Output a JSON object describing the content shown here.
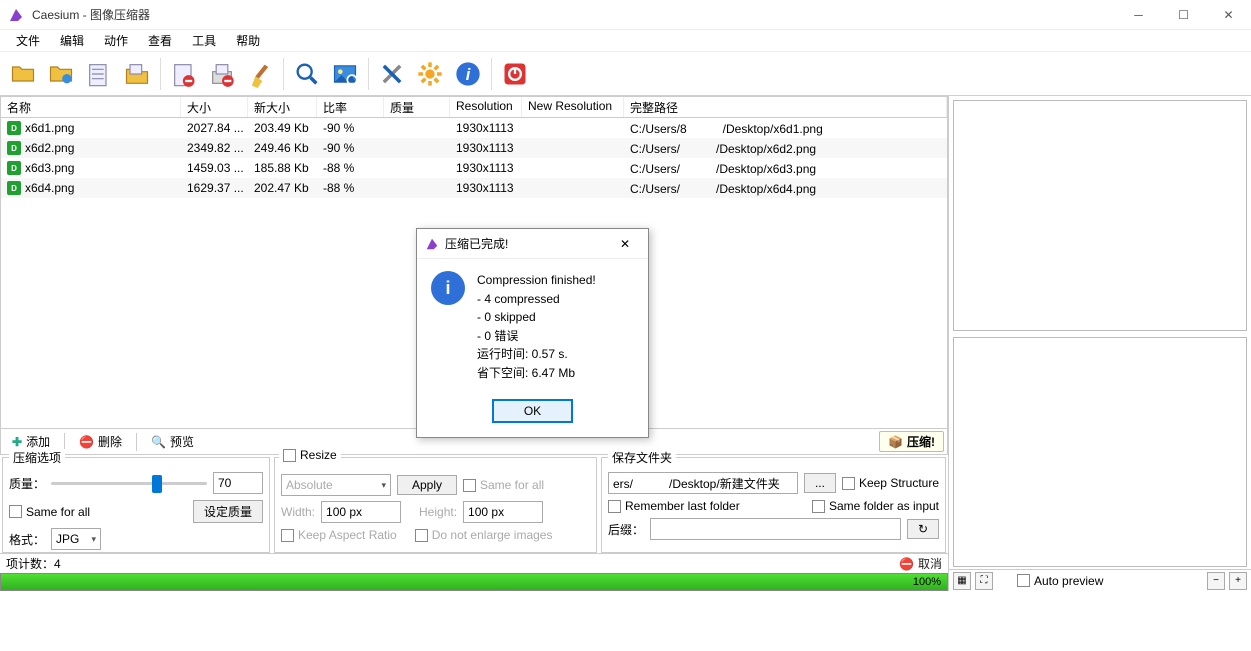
{
  "app": {
    "title": "Caesium - 图像压缩器"
  },
  "menu": [
    "文件",
    "编辑",
    "动作",
    "查看",
    "工具",
    "帮助"
  ],
  "columns": {
    "name": "名称",
    "size": "大小",
    "newsize": "新大小",
    "ratio": "比率",
    "quality": "质量",
    "resolution": "Resolution",
    "newres": "New Resolution",
    "path": "完整路径"
  },
  "files": [
    {
      "name": "x6d1.png",
      "size": "2027.84 ...",
      "newsize": "203.49 Kb",
      "ratio": "-90 %",
      "quality": "",
      "res": "1930x1113",
      "newres": "",
      "path": "C:/Users/8　　　/Desktop/x6d1.png"
    },
    {
      "name": "x6d2.png",
      "size": "2349.82 ...",
      "newsize": "249.46 Kb",
      "ratio": "-90 %",
      "quality": "",
      "res": "1930x1113",
      "newres": "",
      "path": "C:/Users/　　　/Desktop/x6d2.png"
    },
    {
      "name": "x6d3.png",
      "size": "1459.03 ...",
      "newsize": "185.88 Kb",
      "ratio": "-88 %",
      "quality": "",
      "res": "1930x1113",
      "newres": "",
      "path": "C:/Users/　　　/Desktop/x6d3.png"
    },
    {
      "name": "x6d4.png",
      "size": "1629.37 ...",
      "newsize": "202.47 Kb",
      "ratio": "-88 %",
      "quality": "",
      "res": "1930x1113",
      "newres": "",
      "path": "C:/Users/　　　/Desktop/x6d4.png"
    }
  ],
  "actions": {
    "add": "添加",
    "delete": "删除",
    "preview": "预览",
    "compress": "压缩!"
  },
  "compress_opts": {
    "title": "压缩选项",
    "quality_label": "质量：",
    "quality_value": "70",
    "same_for_all": "Same for all",
    "set_quality": "设定质量",
    "format_label": "格式：",
    "format_value": "JPG"
  },
  "resize_opts": {
    "title": "Resize",
    "mode": "Absolute",
    "apply": "Apply",
    "same_for_all": "Same for all",
    "width_label": "Width:",
    "width_value": "100 px",
    "height_label": "Height:",
    "height_value": "100 px",
    "keep_aspect": "Keep Aspect Ratio",
    "no_enlarge": "Do not enlarge images"
  },
  "save_opts": {
    "title": "保存文件夹",
    "path": "ers/　　　/Desktop/新建文件夹",
    "browse": "...",
    "keep_structure": "Keep Structure",
    "remember": "Remember last folder",
    "same_folder": "Same folder as input",
    "suffix_label": "后缀：",
    "suffix_value": ""
  },
  "status": {
    "items_label": "项计数：",
    "items_count": "4",
    "cancel": "取消",
    "progress_text": "100%"
  },
  "preview": {
    "auto": "Auto preview"
  },
  "dialog": {
    "title": "压缩已完成!",
    "lines": [
      "Compression finished!",
      "- 4 compressed",
      "- 0 skipped",
      "- 0 错误",
      "运行时间: 0.57 s.",
      "省下空间: 6.47 Mb"
    ],
    "ok": "OK"
  }
}
